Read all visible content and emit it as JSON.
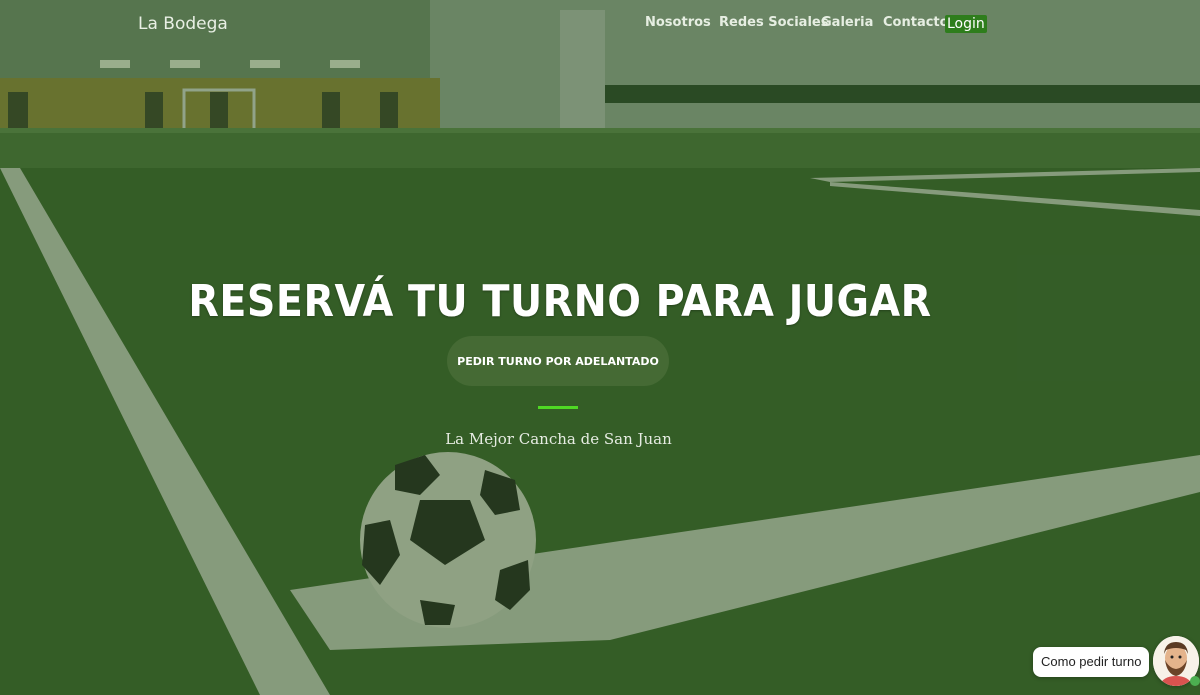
{
  "navbar": {
    "brand": "La Bodega",
    "links": [
      "Nosotros",
      "Redes Sociales",
      "Galeria",
      "Contacto"
    ],
    "login_label": "Login"
  },
  "hero": {
    "title": "RESERVÁ TU TURNO PARA JUGAR",
    "cta_label": "PEDIR TURNO POR ADELANTADO",
    "subtitle": "La Mejor Cancha de San Juan"
  },
  "chat_widget": {
    "label": "Como pedir turno",
    "avatar_icon": "person-avatar-icon"
  },
  "colors": {
    "accent": "#4fd824",
    "button_bg": "#456a34",
    "login_bg": "#2e7d1c"
  }
}
